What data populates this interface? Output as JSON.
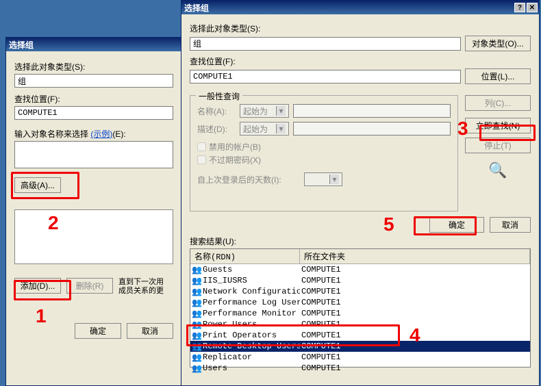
{
  "dialog1": {
    "title": "选择组",
    "objTypeLabel": "选择此对象类型(S):",
    "objTypeValue": "组",
    "findLocLabel": "查找位置(F):",
    "findLocValue": "COMPUTE1",
    "enterNameLabel": "输入对象名称来选择 ",
    "example": "(示例)",
    "enterNameSuffix": "(E):",
    "advanced": "高级(A)...",
    "addBtn": "添加(D)...",
    "removeBtn": "删除(R)",
    "hint1": "直到下一次用",
    "hint2": "成员关系的更",
    "ok": "确定",
    "cancel": "取消"
  },
  "dialog2": {
    "title": "选择组",
    "objTypeLabel": "选择此对象类型(S):",
    "objTypeValue": "组",
    "objTypeBtn": "对象类型(O)...",
    "findLocLabel": "查找位置(F):",
    "findLocValue": "COMPUTE1",
    "locBtn": "位置(L)...",
    "commonQuery": "一般性查询",
    "nameLabel": "名称(A):",
    "descLabel": "描述(D):",
    "startWith": "起始为",
    "disabledAcct": "禁用的帐户(B)",
    "noExpirePwd": "不过期密码(X)",
    "daysSince": "自上次登录后的天数(I):",
    "colBtn": "列(C)...",
    "findNow": "立即查找(N)",
    "stop": "停止(T)",
    "ok": "确定",
    "cancel": "取消",
    "searchResultsLabel": "搜索结果(U):",
    "colName": "名称(RDN)",
    "colFolder": "所在文件夹",
    "rows": [
      {
        "name": "Guests",
        "folder": "COMPUTE1"
      },
      {
        "name": "IIS_IUSRS",
        "folder": "COMPUTE1"
      },
      {
        "name": "Network Configuration O...",
        "folder": "COMPUTE1"
      },
      {
        "name": "Performance Log Users",
        "folder": "COMPUTE1"
      },
      {
        "name": "Performance Monitor Users",
        "folder": "COMPUTE1"
      },
      {
        "name": "Power Users",
        "folder": "COMPUTE1"
      },
      {
        "name": "Print Operators",
        "folder": "COMPUTE1"
      },
      {
        "name": "Remote Desktop Users",
        "folder": "COMPUTE1"
      },
      {
        "name": "Replicator",
        "folder": "COMPUTE1"
      },
      {
        "name": "Users",
        "folder": "COMPUTE1"
      }
    ],
    "selectedRow": 7
  },
  "annotations": {
    "a1": "1",
    "a2": "2",
    "a3": "3",
    "a4": "4",
    "a5": "5"
  }
}
